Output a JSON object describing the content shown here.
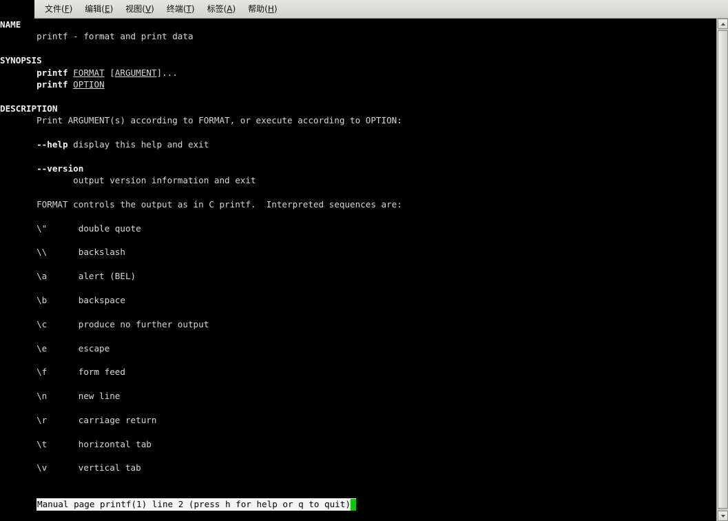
{
  "window": {
    "title": "printf(1) man page",
    "background_color": "#000000",
    "foreground_color": "#d6d6d6",
    "menubar_color": "#dedeD8"
  },
  "menubar": {
    "items": [
      {
        "label": "文件(F)",
        "text": "文件(",
        "mnemonic": "F",
        "tail": ")"
      },
      {
        "label": "编辑(E)",
        "text": "编辑(",
        "mnemonic": "E",
        "tail": ")"
      },
      {
        "label": "视图(V)",
        "text": "视图(",
        "mnemonic": "V",
        "tail": ")"
      },
      {
        "label": "终端(T)",
        "text": "终端(",
        "mnemonic": "T",
        "tail": ")"
      },
      {
        "label": "标签(A)",
        "text": "标签(",
        "mnemonic": "A",
        "tail": ")"
      },
      {
        "label": "帮助(H)",
        "text": "帮助(",
        "mnemonic": "H",
        "tail": ")"
      }
    ]
  },
  "man_page": {
    "command": "printf",
    "section": "1",
    "lines": [
      {
        "text": "NAME",
        "style": "bold"
      },
      {
        "text": "       printf - format and print data",
        "style": "plain"
      },
      {
        "text": "",
        "style": "plain"
      },
      {
        "text": "SYNOPSIS",
        "style": "bold"
      },
      {
        "text": "       printf FORMAT [ARGUMENT]...",
        "style": "synopsis1"
      },
      {
        "text": "       printf OPTION",
        "style": "synopsis2"
      },
      {
        "text": "",
        "style": "plain"
      },
      {
        "text": "DESCRIPTION",
        "style": "bold"
      },
      {
        "text": "       Print ARGUMENT(s) according to FORMAT, or execute according to OPTION:",
        "style": "plain"
      },
      {
        "text": "",
        "style": "plain"
      },
      {
        "text": "       --help display this help and exit",
        "style": "opt_help"
      },
      {
        "text": "",
        "style": "plain"
      },
      {
        "text": "       --version",
        "style": "opt_version"
      },
      {
        "text": "              output version information and exit",
        "style": "plain"
      },
      {
        "text": "",
        "style": "plain"
      },
      {
        "text": "       FORMAT controls the output as in C printf.  Interpreted sequences are:",
        "style": "plain"
      },
      {
        "text": "",
        "style": "plain"
      },
      {
        "text": "       \\\"      double quote",
        "style": "plain"
      },
      {
        "text": "",
        "style": "plain"
      },
      {
        "text": "       \\\\      backslash",
        "style": "plain"
      },
      {
        "text": "",
        "style": "plain"
      },
      {
        "text": "       \\a      alert (BEL)",
        "style": "plain"
      },
      {
        "text": "",
        "style": "plain"
      },
      {
        "text": "       \\b      backspace",
        "style": "plain"
      },
      {
        "text": "",
        "style": "plain"
      },
      {
        "text": "       \\c      produce no further output",
        "style": "plain"
      },
      {
        "text": "",
        "style": "plain"
      },
      {
        "text": "       \\e      escape",
        "style": "plain"
      },
      {
        "text": "",
        "style": "plain"
      },
      {
        "text": "       \\f      form feed",
        "style": "plain"
      },
      {
        "text": "",
        "style": "plain"
      },
      {
        "text": "       \\n      new line",
        "style": "plain"
      },
      {
        "text": "",
        "style": "plain"
      },
      {
        "text": "       \\r      carriage return",
        "style": "plain"
      },
      {
        "text": "",
        "style": "plain"
      },
      {
        "text": "       \\t      horizontal tab",
        "style": "plain"
      },
      {
        "text": "",
        "style": "plain"
      },
      {
        "text": "       \\v      vertical tab",
        "style": "plain"
      }
    ],
    "sections": [
      "NAME",
      "SYNOPSIS",
      "DESCRIPTION"
    ],
    "synopsis": {
      "line1": {
        "cmd": "printf",
        "arg1": "FORMAT",
        "arg2": "[ARGUMENT]...",
        "underlined": [
          "FORMAT",
          "ARGUMENT"
        ]
      },
      "line2": {
        "cmd": "printf",
        "arg1": "OPTION",
        "underlined": [
          "OPTION"
        ]
      }
    },
    "options": [
      {
        "flag": "--help",
        "desc": "display this help and exit"
      },
      {
        "flag": "--version",
        "desc": "output version information and exit"
      }
    ],
    "escape_sequences": [
      {
        "seq": "\\\"",
        "desc": "double quote"
      },
      {
        "seq": "\\\\",
        "desc": "backslash"
      },
      {
        "seq": "\\a",
        "desc": "alert (BEL)"
      },
      {
        "seq": "\\b",
        "desc": "backspace"
      },
      {
        "seq": "\\c",
        "desc": "produce no further output"
      },
      {
        "seq": "\\e",
        "desc": "escape"
      },
      {
        "seq": "\\f",
        "desc": "form feed"
      },
      {
        "seq": "\\n",
        "desc": "new line"
      },
      {
        "seq": "\\r",
        "desc": "carriage return"
      },
      {
        "seq": "\\t",
        "desc": "horizontal tab"
      },
      {
        "seq": "\\v",
        "desc": "vertical tab"
      }
    ]
  },
  "status": {
    "text": "Manual page printf(1) line 2 (press h for help or q to quit)",
    "cursor_color": "#00cc00",
    "background_color": "#f4f4f4",
    "text_color": "#000000"
  },
  "scrollbar": {
    "up_arrow": "▲",
    "down_arrow": "▼",
    "thumb_position": "top"
  }
}
